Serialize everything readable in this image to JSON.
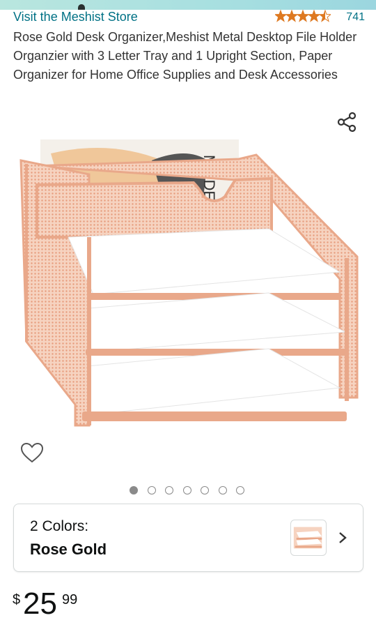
{
  "store": {
    "link_text": "Visit the Meshist Store",
    "rating_value": 4.5,
    "rating_count": "741"
  },
  "product": {
    "title": "Rose Gold Desk Organizer,Meshist Metal Desktop File Holder Organzier with 3 Letter Tray and 1 Upright Section, Paper Organizer for Home Office Supplies and Desk Accessories",
    "image_alt_icon": "desk-organizer-product-image",
    "paper_text": "MODELA"
  },
  "gallery": {
    "total_images": 7,
    "active_index": 0
  },
  "actions": {
    "share_icon": "share-icon",
    "wishlist_icon": "heart-icon"
  },
  "variant": {
    "label": "2 Colors:",
    "value": "Rose Gold",
    "chevron_icon": "chevron-right-icon"
  },
  "price": {
    "symbol": "$",
    "whole": "25",
    "fraction": "99"
  },
  "colors": {
    "link": "#007185",
    "star": "#de7921",
    "rose_gold": "#e9a88a",
    "mesh": "#f1c1a8",
    "tray": "#ffffff"
  }
}
